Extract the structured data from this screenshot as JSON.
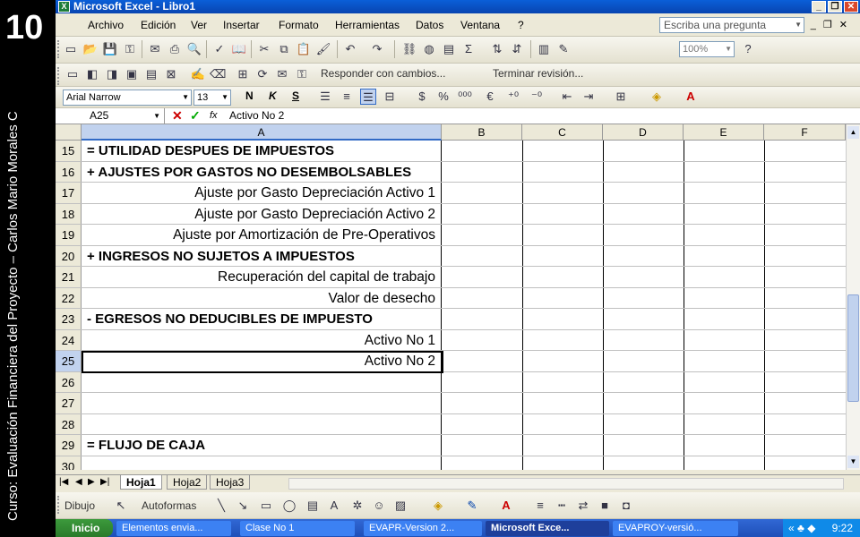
{
  "slide": {
    "number": "10",
    "course_caption": "Curso: Evaluación Financiera del Proyecto – Carlos Mario Morales C"
  },
  "window": {
    "title": "Microsoft Excel - Libro1",
    "controls": [
      "_",
      "❐",
      "✕"
    ]
  },
  "menu": {
    "items": [
      "Archivo",
      "Edición",
      "Ver",
      "Insertar",
      "Formato",
      "Herramientas",
      "Datos",
      "Ventana",
      "?"
    ],
    "help_placeholder": "Escriba una pregunta"
  },
  "toolbar": {
    "zoom": "100%",
    "review_reply": "Responder con cambios...",
    "review_end": "Terminar revisión...",
    "font_name": "Arial Narrow",
    "font_size": "13",
    "bold": "N",
    "italic": "K",
    "underline": "S"
  },
  "formula_bar": {
    "name_box": "A25",
    "fx": "fx",
    "content": "Activo No 2"
  },
  "columns": [
    "A",
    "B",
    "C",
    "D",
    "E",
    "F"
  ],
  "rows": [
    {
      "n": "15",
      "a": "= UTILIDAD DESPUES DE IMPUESTOS",
      "style": "bold"
    },
    {
      "n": "16",
      "a": "+ AJUSTES POR GASTOS NO DESEMBOLSABLES",
      "style": "bold"
    },
    {
      "n": "17",
      "a": "Ajuste por Gasto Depreciación Activo 1",
      "style": "right"
    },
    {
      "n": "18",
      "a": "Ajuste por Gasto Depreciación Activo 2",
      "style": "right"
    },
    {
      "n": "19",
      "a": "Ajuste por Amortización de Pre-Operativos",
      "style": "right"
    },
    {
      "n": "20",
      "a": "+ INGRESOS NO SUJETOS A IMPUESTOS",
      "style": "bold"
    },
    {
      "n": "21",
      "a": "Recuperación del capital de trabajo",
      "style": "right"
    },
    {
      "n": "22",
      "a": "Valor de desecho",
      "style": "right"
    },
    {
      "n": "23",
      "a": "- EGRESOS NO DEDUCIBLES DE IMPUESTO",
      "style": "bold"
    },
    {
      "n": "24",
      "a": "Activo No 1",
      "style": "right"
    },
    {
      "n": "25",
      "a": "Activo No 2",
      "style": "right"
    },
    {
      "n": "26",
      "a": "",
      "style": ""
    },
    {
      "n": "27",
      "a": "",
      "style": ""
    },
    {
      "n": "28",
      "a": "",
      "style": ""
    },
    {
      "n": "29",
      "a": "= FLUJO DE CAJA",
      "style": "bold"
    },
    {
      "n": "30",
      "a": "",
      "style": ""
    }
  ],
  "sheets": [
    "Hoja1",
    "Hoja2",
    "Hoja3"
  ],
  "drawing": {
    "draw_label": "Dibujo",
    "autoshapes_label": "Autoformas"
  },
  "taskbar": {
    "start": "Inicio",
    "tasks": [
      "Elementos envia...",
      "Clase No 1",
      "EVAPR-Version 2...",
      "Microsoft Exce...",
      "EVAPROY-versió..."
    ],
    "clock": "9:22"
  },
  "colors": {
    "title_bar": "#0a5fd8",
    "selection": "#c1d2ee",
    "taskbar": "#1e4fb8"
  }
}
